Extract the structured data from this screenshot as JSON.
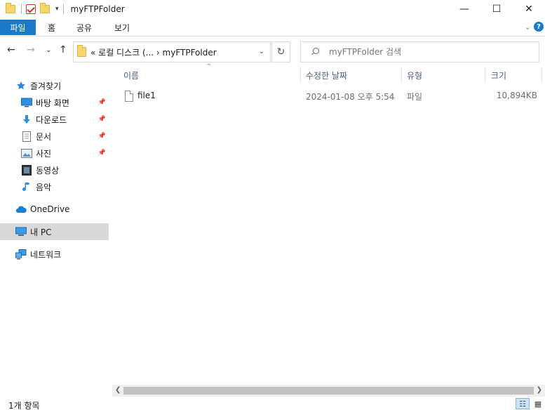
{
  "window": {
    "title": "myFTPFolder",
    "minimize": "—",
    "maximize": "☐",
    "close": "✕"
  },
  "ribbon": {
    "tabs": [
      "파일",
      "홈",
      "공유",
      "보기"
    ],
    "expand_icon": "⌄",
    "help": "?"
  },
  "address": {
    "path": "« 로컬 디스크 (... › myFTPFolder",
    "chevron": "⌄",
    "refresh": "↻"
  },
  "search": {
    "placeholder": "myFTPFolder 검색"
  },
  "nav": {
    "back": "←",
    "forward": "→",
    "recent": "⌄",
    "up": "↑"
  },
  "sidebar": {
    "items": [
      {
        "label": "즐겨찾기",
        "icon": "star-icon"
      },
      {
        "label": "바탕 화면",
        "icon": "desktop-icon",
        "pinned": true
      },
      {
        "label": "다운로드",
        "icon": "download-icon",
        "pinned": true
      },
      {
        "label": "문서",
        "icon": "document-icon",
        "pinned": true
      },
      {
        "label": "사진",
        "icon": "pictures-icon",
        "pinned": true
      },
      {
        "label": "동영상",
        "icon": "video-icon"
      },
      {
        "label": "음악",
        "icon": "music-icon"
      },
      {
        "label": "OneDrive",
        "icon": "cloud-icon"
      },
      {
        "label": "내 PC",
        "icon": "pc-icon",
        "selected": true
      },
      {
        "label": "네트워크",
        "icon": "network-icon"
      }
    ]
  },
  "columns": {
    "name": "이름",
    "modified": "수정한 날짜",
    "type": "유형",
    "size": "크기"
  },
  "files": [
    {
      "name": "file1",
      "modified": "2024-01-08 오후 5:54",
      "type": "파일",
      "size": "10,894KB"
    }
  ],
  "status": {
    "count": "1개 항목"
  },
  "colors": {
    "accent": "#1979ca",
    "selected_bg": "#d9d9d9",
    "header_text": "#4c607a"
  }
}
